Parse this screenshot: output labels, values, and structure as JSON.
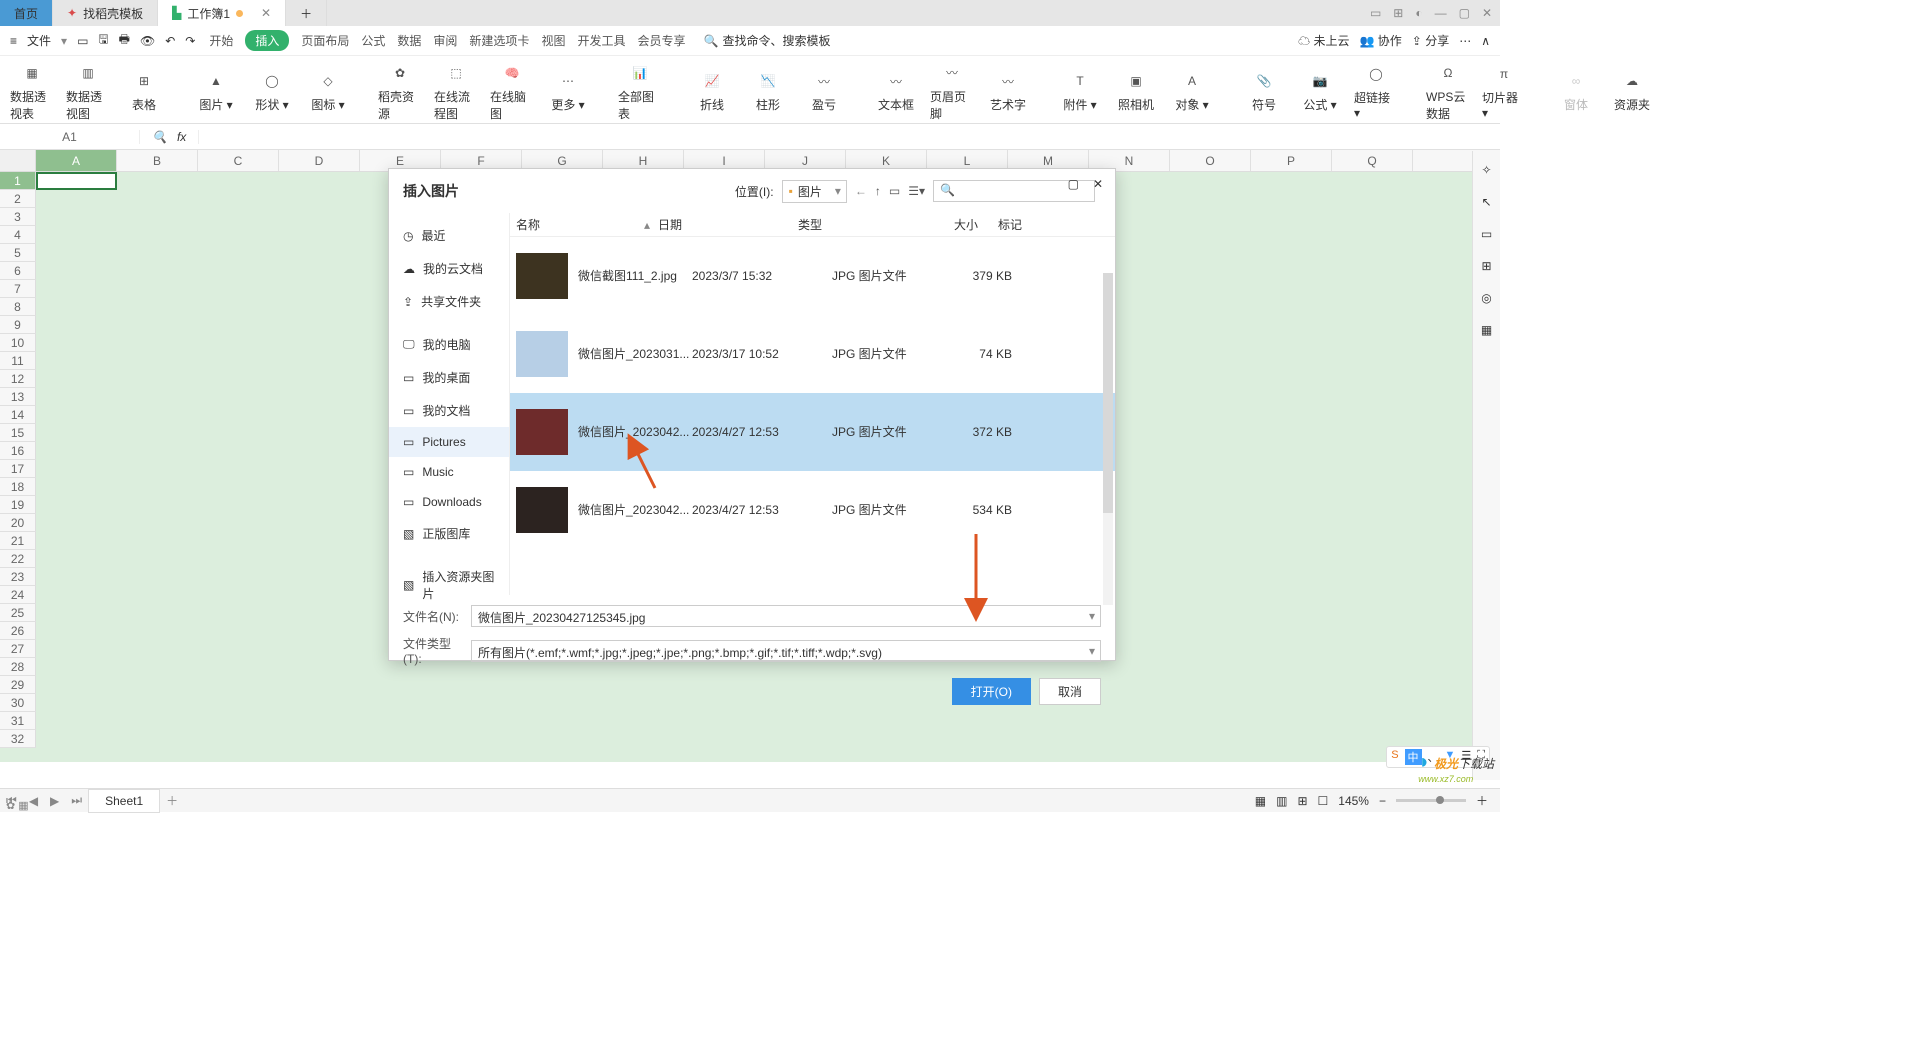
{
  "tabs": {
    "home": "首页",
    "template": "找稻壳模板",
    "workbook": "工作簿1"
  },
  "menu": {
    "file": "文件",
    "items": [
      "开始",
      "插入",
      "页面布局",
      "公式",
      "数据",
      "审阅",
      "新建选项卡",
      "视图",
      "开发工具",
      "会员专享"
    ],
    "activeIndex": 1,
    "searchPlaceholder": "查找命令、搜索模板",
    "right": [
      "未上云",
      "协作",
      "分享"
    ]
  },
  "ribbon": [
    "数据透视表",
    "数据透视图",
    "表格",
    "图片",
    "形状",
    "图标",
    "稻壳资源",
    "在线流程图",
    "在线脑图",
    "更多",
    "全部图表",
    "折线",
    "柱形",
    "盈亏",
    "文本框",
    "页眉页脚",
    "艺术字",
    "附件",
    "照相机",
    "对象",
    "符号",
    "公式",
    "超链接",
    "WPS云数据",
    "切片器",
    "窗体",
    "资源夹"
  ],
  "namebox": "A1",
  "columns": [
    "A",
    "B",
    "C",
    "D",
    "E",
    "F",
    "G",
    "H",
    "I",
    "J",
    "K",
    "L",
    "M",
    "N",
    "O",
    "P",
    "Q"
  ],
  "sheet": {
    "tab": "Sheet1"
  },
  "status": {
    "zoom": "145%"
  },
  "dialog": {
    "title": "插入图片",
    "locLabel": "位置(I):",
    "locValue": "图片",
    "searchPlaceholder": "",
    "sidebar": [
      {
        "icon": "clock",
        "label": "最近"
      },
      {
        "icon": "cloud",
        "label": "我的云文档"
      },
      {
        "icon": "share",
        "label": "共享文件夹"
      },
      {
        "icon": "monitor",
        "label": "我的电脑"
      },
      {
        "icon": "desktop",
        "label": "我的桌面"
      },
      {
        "icon": "doc",
        "label": "我的文档"
      },
      {
        "icon": "folder",
        "label": "Pictures"
      },
      {
        "icon": "folder",
        "label": "Music"
      },
      {
        "icon": "folder",
        "label": "Downloads"
      },
      {
        "icon": "image",
        "label": "正版图库"
      },
      {
        "icon": "image",
        "label": "插入资源夹图片"
      }
    ],
    "sidebarActive": 6,
    "columns": {
      "name": "名称",
      "date": "日期",
      "type": "类型",
      "size": "大小",
      "tag": "标记"
    },
    "files": [
      {
        "name": "微信截图111_2.jpg",
        "date": "2023/3/7 15:32",
        "type": "JPG 图片文件",
        "size": "379 KB",
        "thumb": "#3d3320"
      },
      {
        "name": "微信图片_2023031...",
        "date": "2023/3/17 10:52",
        "type": "JPG 图片文件",
        "size": "74 KB",
        "thumb": "#b7cfe6"
      },
      {
        "name": "微信图片_2023042...",
        "date": "2023/4/27 12:53",
        "type": "JPG 图片文件",
        "size": "372 KB",
        "thumb": "#6e2b2b",
        "selected": true
      },
      {
        "name": "微信图片_2023042...",
        "date": "2023/4/27 12:53",
        "type": "JPG 图片文件",
        "size": "534 KB",
        "thumb": "#2c2320"
      }
    ],
    "filenameLabel": "文件名(N):",
    "filename": "微信图片_20230427125345.jpg",
    "filetypeLabel": "文件类型(T):",
    "filetype": "所有图片(*.emf;*.wmf;*.jpg;*.jpeg;*.jpe;*.png;*.bmp;*.gif;*.tif;*.tiff;*.wdp;*.svg)",
    "open": "打开(O)",
    "cancel": "取消"
  },
  "watermark": {
    "a": "极光",
    "b": "下载站"
  },
  "badge": [
    "中",
    "、",
    "▼",
    "☰",
    "⛶"
  ]
}
